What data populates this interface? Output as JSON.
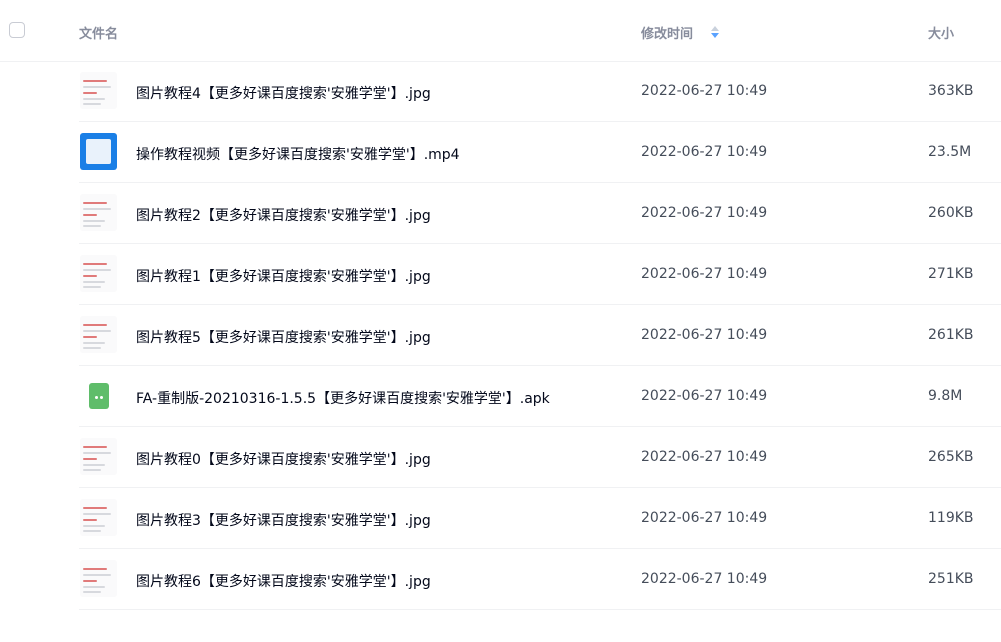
{
  "header": {
    "name_label": "文件名",
    "time_label": "修改时间",
    "size_label": "大小"
  },
  "files": [
    {
      "name": "图片教程4【更多好课百度搜索'安雅学堂'】.jpg",
      "modified": "2022-06-27 10:49",
      "size": "363KB",
      "type": "image"
    },
    {
      "name": "操作教程视频【更多好课百度搜索'安雅学堂'】.mp4",
      "modified": "2022-06-27 10:49",
      "size": "23.5M",
      "type": "video"
    },
    {
      "name": "图片教程2【更多好课百度搜索'安雅学堂'】.jpg",
      "modified": "2022-06-27 10:49",
      "size": "260KB",
      "type": "image"
    },
    {
      "name": "图片教程1【更多好课百度搜索'安雅学堂'】.jpg",
      "modified": "2022-06-27 10:49",
      "size": "271KB",
      "type": "image"
    },
    {
      "name": "图片教程5【更多好课百度搜索'安雅学堂'】.jpg",
      "modified": "2022-06-27 10:49",
      "size": "261KB",
      "type": "image"
    },
    {
      "name": "FA-重制版-20210316-1.5.5【更多好课百度搜索'安雅学堂'】.apk",
      "modified": "2022-06-27 10:49",
      "size": "9.8M",
      "type": "apk"
    },
    {
      "name": "图片教程0【更多好课百度搜索'安雅学堂'】.jpg",
      "modified": "2022-06-27 10:49",
      "size": "265KB",
      "type": "image"
    },
    {
      "name": "图片教程3【更多好课百度搜索'安雅学堂'】.jpg",
      "modified": "2022-06-27 10:49",
      "size": "119KB",
      "type": "image"
    },
    {
      "name": "图片教程6【更多好课百度搜索'安雅学堂'】.jpg",
      "modified": "2022-06-27 10:49",
      "size": "251KB",
      "type": "image"
    }
  ],
  "colors": {
    "sort_active": "#5aa2ff",
    "sort_inactive": "#c9d1dc",
    "apk": "#5fbd6a",
    "video": "#1a7fe6"
  }
}
